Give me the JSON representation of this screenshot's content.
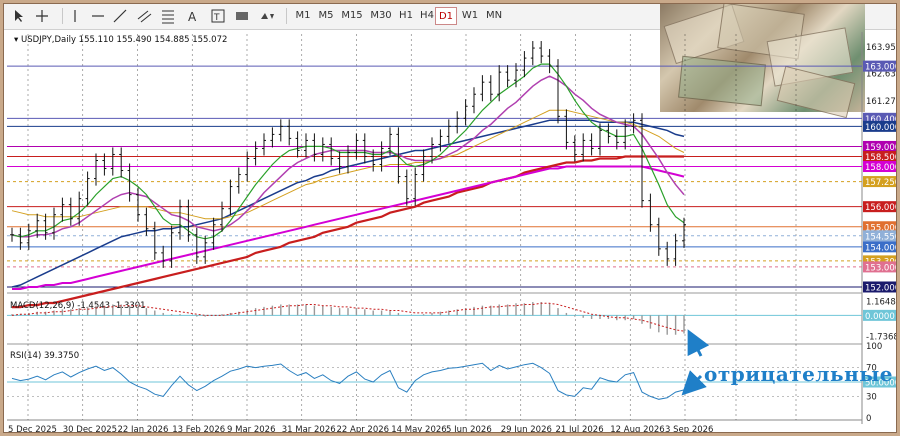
{
  "toolbar": {
    "timeframes": [
      "M1",
      "M5",
      "M15",
      "M30",
      "H1",
      "H4",
      "D1",
      "W1",
      "MN"
    ],
    "selected": "D1",
    "tools": [
      "cursor-icon",
      "crosshair-icon",
      "vertical-line-icon",
      "horizontal-line-icon",
      "trend-line-icon",
      "equidistant-channel-icon",
      "fibonacci-icon",
      "text-icon",
      "label-icon",
      "rectangle-icon",
      "shapes-icon"
    ]
  },
  "chart_data": [
    {
      "type": "line",
      "title": "USDJPY,Daily",
      "ohlc": {
        "open": "155.110",
        "high": "155.490",
        "low": "154.885",
        "close": "155.072"
      },
      "x_tick_labels": [
        "5 Dec 2025",
        "30 Dec 2025",
        "22 Jan 2026",
        "13 Feb 2026",
        "9 Mar 2026",
        "31 Mar 2026",
        "22 Apr 2026",
        "14 May 2026",
        "5 Jun 2026",
        "29 Jun 2026",
        "21 Jul 2026",
        "12 Aug 2026",
        "3 Sep 2026"
      ],
      "y_tick_labels": [
        "163.950",
        "162.630",
        "161.270",
        "159.950",
        "158.500",
        "157.250",
        "156.000",
        "154.550",
        "153.300",
        "152.000"
      ],
      "ylim": [
        151.8,
        164.6
      ],
      "price_levels": [
        {
          "label": "163.000",
          "value": 163.0,
          "color": "#5a5ab4"
        },
        {
          "label": "160.400",
          "value": 160.4,
          "color": "#5a5ab4"
        },
        {
          "label": "160.000",
          "value": 160.0,
          "color": "#1a3c8c"
        },
        {
          "label": "159.000",
          "value": 159.0,
          "color": "#b000b0"
        },
        {
          "label": "158.500",
          "value": 158.5,
          "color": "#c81e1e"
        },
        {
          "label": "158.000",
          "value": 158.0,
          "color": "#d400d4"
        },
        {
          "label": "157.250",
          "value": 157.25,
          "color": "#d4a020"
        },
        {
          "label": "156.000",
          "value": 156.0,
          "color": "#c81e1e"
        },
        {
          "label": "155.000",
          "value": 155.0,
          "color": "#e07030"
        },
        {
          "label": "154.550",
          "value": 154.55,
          "color": "#90b0d8"
        },
        {
          "label": "154.000",
          "value": 154.0,
          "color": "#3a6ec8"
        },
        {
          "label": "153.300",
          "value": 153.3,
          "color": "#d4a020"
        },
        {
          "label": "153.000",
          "value": 153.0,
          "color": "#e07090"
        },
        {
          "label": "152.000",
          "value": 152.0,
          "color": "#1a1a6c"
        }
      ],
      "close": [
        154.6,
        154.2,
        154.8,
        155.3,
        154.7,
        155.6,
        156.1,
        155.4,
        156.4,
        157.4,
        158.3,
        157.9,
        158.6,
        157.8,
        156.6,
        155.6,
        154.9,
        153.7,
        153.3,
        154.7,
        156.0,
        154.6,
        153.5,
        154.2,
        155.1,
        155.9,
        157.0,
        157.6,
        158.4,
        158.9,
        159.3,
        159.6,
        160.0,
        159.4,
        158.8,
        159.3,
        158.6,
        159.1,
        158.4,
        158.0,
        158.7,
        159.3,
        158.5,
        158.1,
        158.9,
        159.6,
        157.5,
        156.4,
        157.6,
        158.5,
        159.1,
        159.5,
        160.0,
        160.4,
        161.0,
        161.6,
        162.2,
        161.6,
        162.7,
        162.3,
        162.8,
        163.4,
        163.9,
        163.5,
        163.0,
        160.5,
        159.2,
        158.6,
        159.3,
        158.9,
        159.8,
        159.5,
        159.2,
        160.0,
        160.3,
        156.3,
        155.1,
        153.9,
        153.4,
        154.3,
        155.1
      ],
      "ma_fast": [
        154.6,
        154.5,
        154.6,
        154.8,
        154.8,
        155.0,
        155.3,
        155.4,
        155.7,
        156.1,
        156.6,
        157.0,
        157.4,
        157.5,
        157.3,
        157.0,
        156.6,
        156.0,
        155.4,
        155.1,
        155.1,
        154.8,
        154.5,
        154.4,
        154.5,
        154.8,
        155.3,
        155.9,
        156.5,
        157.1,
        157.6,
        158.1,
        158.5,
        158.8,
        158.9,
        159.0,
        159.0,
        159.0,
        158.9,
        158.7,
        158.7,
        158.7,
        158.7,
        158.6,
        158.6,
        158.8,
        158.5,
        158.1,
        158.0,
        158.1,
        158.3,
        158.6,
        159.0,
        159.4,
        159.8,
        160.3,
        160.8,
        161.2,
        161.6,
        161.9,
        162.2,
        162.5,
        162.9,
        163.1,
        163.1,
        162.6,
        162.0,
        161.3,
        160.7,
        160.2,
        159.9,
        159.7,
        159.5,
        159.5,
        159.6,
        158.9,
        158.0,
        157.1,
        156.1,
        155.5,
        155.2
      ],
      "ma_mid": [
        154.6,
        154.5,
        154.5,
        154.6,
        154.6,
        154.7,
        154.9,
        155.0,
        155.2,
        155.5,
        155.8,
        156.1,
        156.4,
        156.6,
        156.7,
        156.6,
        156.5,
        156.2,
        155.9,
        155.6,
        155.5,
        155.3,
        155.0,
        154.9,
        154.8,
        154.9,
        155.1,
        155.4,
        155.8,
        156.2,
        156.7,
        157.1,
        157.5,
        157.9,
        158.2,
        158.4,
        158.6,
        158.7,
        158.8,
        158.8,
        158.8,
        158.8,
        158.8,
        158.7,
        158.7,
        158.7,
        158.6,
        158.4,
        158.3,
        158.3,
        158.3,
        158.4,
        158.6,
        158.8,
        159.1,
        159.4,
        159.8,
        160.1,
        160.5,
        160.9,
        161.2,
        161.6,
        162.0,
        162.3,
        162.5,
        162.3,
        162.0,
        161.6,
        161.3,
        160.9,
        160.6,
        160.4,
        160.2,
        160.1,
        160.0,
        159.6,
        159.0,
        158.4,
        157.7,
        157.1,
        156.6
      ],
      "ma_slow": [
        155.8,
        155.7,
        155.6,
        155.6,
        155.5,
        155.5,
        155.5,
        155.5,
        155.5,
        155.6,
        155.7,
        155.8,
        155.9,
        156.0,
        156.0,
        156.0,
        156.0,
        155.9,
        155.8,
        155.7,
        155.7,
        155.6,
        155.5,
        155.4,
        155.4,
        155.4,
        155.5,
        155.6,
        155.7,
        155.9,
        156.1,
        156.3,
        156.5,
        156.7,
        156.9,
        157.1,
        157.2,
        157.4,
        157.5,
        157.6,
        157.7,
        157.8,
        157.9,
        158.0,
        158.0,
        158.1,
        158.1,
        158.1,
        158.2,
        158.2,
        158.3,
        158.4,
        158.5,
        158.6,
        158.8,
        159.0,
        159.2,
        159.4,
        159.6,
        159.8,
        160.0,
        160.2,
        160.4,
        160.6,
        160.8,
        160.8,
        160.8,
        160.7,
        160.6,
        160.5,
        160.4,
        160.3,
        160.2,
        160.2,
        160.1,
        159.9,
        159.7,
        159.5,
        159.2,
        158.9,
        158.7
      ],
      "ma_blue": [
        152.0,
        152.1,
        152.3,
        152.5,
        152.7,
        152.9,
        153.1,
        153.3,
        153.5,
        153.7,
        153.9,
        154.1,
        154.3,
        154.5,
        154.6,
        154.7,
        154.8,
        154.8,
        154.9,
        154.9,
        155.0,
        155.0,
        155.1,
        155.2,
        155.3,
        155.4,
        155.6,
        155.8,
        156.0,
        156.2,
        156.4,
        156.6,
        156.8,
        157.0,
        157.2,
        157.3,
        157.5,
        157.6,
        157.8,
        157.9,
        158.0,
        158.1,
        158.2,
        158.3,
        158.4,
        158.5,
        158.6,
        158.7,
        158.8,
        158.8,
        158.9,
        159.0,
        159.1,
        159.2,
        159.3,
        159.4,
        159.5,
        159.6,
        159.7,
        159.8,
        159.9,
        160.0,
        160.1,
        160.2,
        160.3,
        160.3,
        160.3,
        160.3,
        160.3,
        160.3,
        160.2,
        160.2,
        160.2,
        160.2,
        160.2,
        160.1,
        160.0,
        159.9,
        159.8,
        159.6,
        159.5
      ],
      "ma_magenta": [
        151.9,
        151.9,
        152.0,
        152.0,
        152.1,
        152.1,
        152.2,
        152.2,
        152.3,
        152.4,
        152.5,
        152.6,
        152.7,
        152.8,
        152.9,
        153.0,
        153.1,
        153.2,
        153.3,
        153.4,
        153.5,
        153.6,
        153.7,
        153.8,
        153.9,
        154.0,
        154.1,
        154.2,
        154.3,
        154.4,
        154.5,
        154.6,
        154.7,
        154.8,
        154.9,
        155.0,
        155.1,
        155.2,
        155.3,
        155.4,
        155.5,
        155.6,
        155.7,
        155.8,
        155.9,
        156.0,
        156.1,
        156.2,
        156.3,
        156.4,
        156.5,
        156.6,
        156.7,
        156.8,
        156.9,
        157.0,
        157.1,
        157.2,
        157.3,
        157.4,
        157.5,
        157.6,
        157.7,
        157.8,
        157.9,
        157.9,
        158.0,
        158.0,
        158.0,
        158.0,
        158.0,
        158.0,
        158.0,
        158.0,
        158.0,
        158.0,
        157.9,
        157.8,
        157.7,
        157.6,
        157.5
      ],
      "ma_red": [
        151.0,
        151.0,
        151.1,
        151.1,
        151.2,
        151.2,
        151.3,
        151.4,
        151.5,
        151.6,
        151.7,
        151.8,
        151.9,
        152.0,
        152.1,
        152.2,
        152.3,
        152.4,
        152.5,
        152.6,
        152.7,
        152.8,
        152.9,
        153.0,
        153.1,
        153.2,
        153.3,
        153.4,
        153.5,
        153.7,
        153.8,
        153.9,
        154.0,
        154.2,
        154.3,
        154.4,
        154.5,
        154.7,
        154.8,
        154.9,
        155.0,
        155.2,
        155.3,
        155.4,
        155.5,
        155.7,
        155.8,
        155.9,
        156.0,
        156.2,
        156.3,
        156.4,
        156.5,
        156.7,
        156.8,
        156.9,
        157.0,
        157.2,
        157.3,
        157.4,
        157.5,
        157.7,
        157.8,
        157.9,
        158.0,
        158.1,
        158.2,
        158.2,
        158.3,
        158.3,
        158.4,
        158.4,
        158.4,
        158.5,
        158.5,
        158.5,
        158.5,
        158.5,
        158.5,
        158.5,
        158.5
      ]
    },
    {
      "type": "bar",
      "title": "MACD(12,26,9) -1.4543 -1.3301",
      "y_tick_labels": [
        "1.1648",
        "0.0000",
        "-1.7368"
      ],
      "ylim": [
        -2.2,
        1.6
      ],
      "histogram": [
        0.1,
        0.1,
        0.2,
        0.3,
        0.3,
        0.4,
        0.5,
        0.5,
        0.6,
        0.7,
        0.8,
        0.8,
        0.9,
        0.9,
        0.8,
        0.7,
        0.6,
        0.4,
        0.2,
        0.1,
        0.1,
        0.0,
        -0.1,
        -0.1,
        0.0,
        0.1,
        0.2,
        0.3,
        0.5,
        0.6,
        0.7,
        0.8,
        0.9,
        0.9,
        0.9,
        0.9,
        0.8,
        0.8,
        0.7,
        0.6,
        0.6,
        0.6,
        0.5,
        0.4,
        0.4,
        0.4,
        0.2,
        0.0,
        0.0,
        0.1,
        0.2,
        0.3,
        0.4,
        0.5,
        0.6,
        0.7,
        0.8,
        0.8,
        0.9,
        0.9,
        1.0,
        1.0,
        1.1,
        1.1,
        1.0,
        0.6,
        0.2,
        -0.1,
        -0.2,
        -0.3,
        -0.3,
        -0.3,
        -0.4,
        -0.4,
        -0.3,
        -0.7,
        -1.1,
        -1.4,
        -1.6,
        -1.6,
        -1.5
      ],
      "signal": [
        0.0,
        0.1,
        0.1,
        0.2,
        0.2,
        0.3,
        0.3,
        0.4,
        0.5,
        0.5,
        0.6,
        0.7,
        0.7,
        0.8,
        0.8,
        0.8,
        0.7,
        0.6,
        0.5,
        0.4,
        0.3,
        0.2,
        0.1,
        0.0,
        0.0,
        0.0,
        0.1,
        0.2,
        0.3,
        0.4,
        0.5,
        0.6,
        0.7,
        0.8,
        0.8,
        0.9,
        0.9,
        0.8,
        0.8,
        0.7,
        0.7,
        0.6,
        0.6,
        0.5,
        0.5,
        0.4,
        0.4,
        0.3,
        0.2,
        0.2,
        0.2,
        0.2,
        0.3,
        0.4,
        0.5,
        0.5,
        0.6,
        0.7,
        0.7,
        0.8,
        0.8,
        0.9,
        0.9,
        1.0,
        1.0,
        0.9,
        0.7,
        0.5,
        0.3,
        0.1,
        0.0,
        -0.1,
        -0.2,
        -0.2,
        -0.3,
        -0.4,
        -0.6,
        -0.8,
        -1.0,
        -1.2,
        -1.3
      ]
    },
    {
      "type": "line",
      "title": "RSI(14) 39.3750",
      "y_tick_labels": [
        "100",
        "70",
        "50.0000",
        "30",
        "0"
      ],
      "ylim": [
        0,
        100
      ],
      "values": [
        55,
        52,
        54,
        58,
        53,
        60,
        64,
        57,
        63,
        68,
        72,
        66,
        70,
        61,
        50,
        44,
        40,
        33,
        30,
        45,
        58,
        46,
        38,
        44,
        52,
        58,
        65,
        68,
        72,
        70,
        72,
        73,
        75,
        66,
        59,
        63,
        55,
        60,
        52,
        48,
        58,
        64,
        54,
        50,
        60,
        66,
        42,
        36,
        52,
        60,
        64,
        66,
        69,
        70,
        72,
        74,
        76,
        66,
        73,
        68,
        71,
        74,
        76,
        70,
        62,
        38,
        32,
        30,
        42,
        40,
        56,
        52,
        50,
        60,
        63,
        36,
        30,
        26,
        28,
        36,
        39
      ]
    }
  ],
  "annotation": "отрицательные"
}
